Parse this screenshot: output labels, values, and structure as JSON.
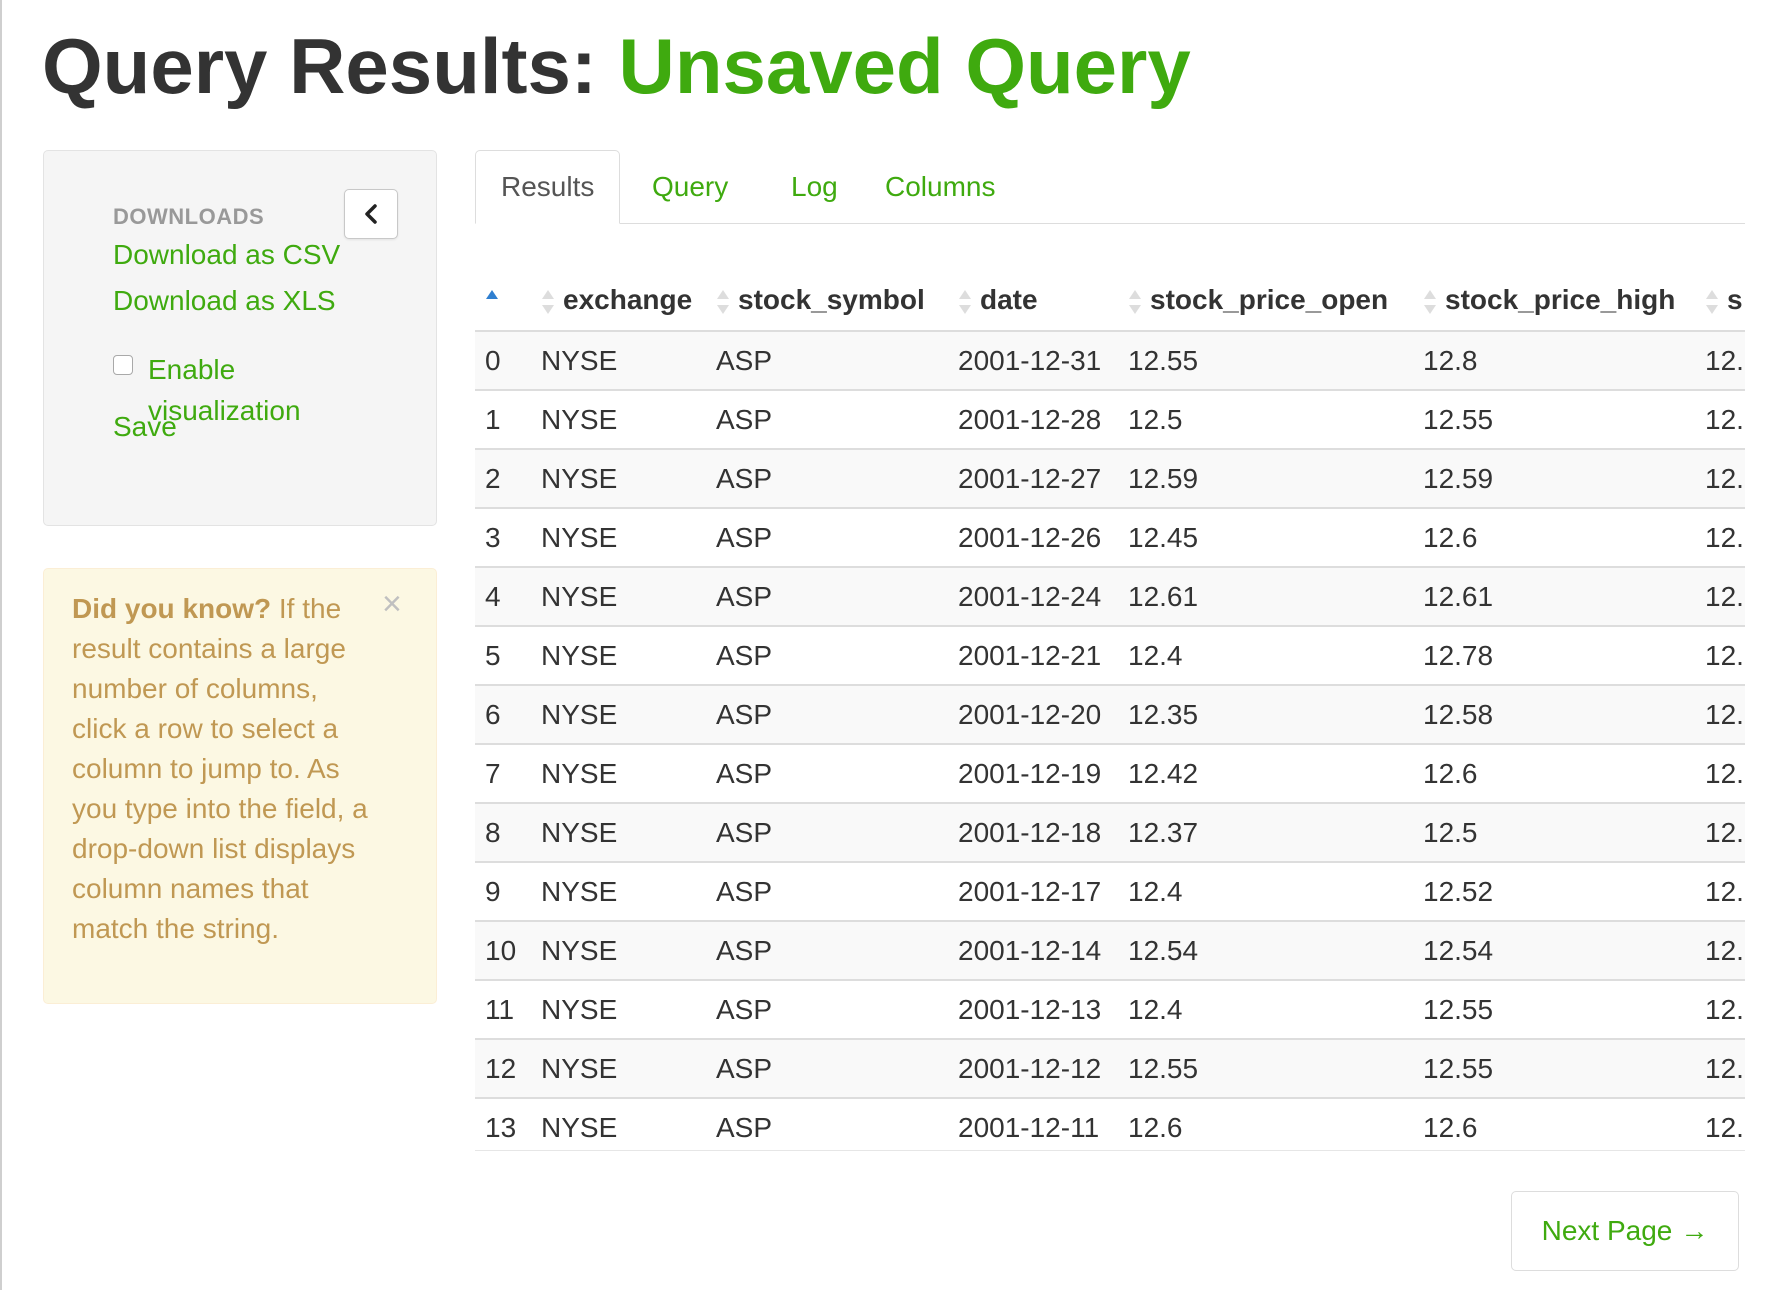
{
  "page": {
    "title_prefix": "Query Results:",
    "title_query": "Unsaved Query"
  },
  "sidebar": {
    "downloads_header": "DOWNLOADS",
    "collapse_icon": "chevron-left-icon",
    "links": {
      "csv": "Download as CSV",
      "xls": "Download as XLS",
      "enable_viz": "Enable visualization",
      "save": "Save"
    },
    "enable_viz_checked": false
  },
  "tip": {
    "heading": "Did you know?",
    "body": "If the result contains a large number of columns, click a row to select a column to jump to. As you type into the field, a drop-down list displays column names that match the string.",
    "close_icon": "close-icon"
  },
  "tabs": [
    {
      "label": "Results",
      "active": true
    },
    {
      "label": "Query",
      "active": false
    },
    {
      "label": "Log",
      "active": false
    },
    {
      "label": "Columns",
      "active": false
    }
  ],
  "table": {
    "columns": [
      "",
      "exchange",
      "stock_symbol",
      "date",
      "stock_price_open",
      "stock_price_high",
      "s"
    ],
    "rows": [
      [
        "0",
        "NYSE",
        "ASP",
        "2001-12-31",
        "12.55",
        "12.8",
        "12."
      ],
      [
        "1",
        "NYSE",
        "ASP",
        "2001-12-28",
        "12.5",
        "12.55",
        "12."
      ],
      [
        "2",
        "NYSE",
        "ASP",
        "2001-12-27",
        "12.59",
        "12.59",
        "12."
      ],
      [
        "3",
        "NYSE",
        "ASP",
        "2001-12-26",
        "12.45",
        "12.6",
        "12."
      ],
      [
        "4",
        "NYSE",
        "ASP",
        "2001-12-24",
        "12.61",
        "12.61",
        "12."
      ],
      [
        "5",
        "NYSE",
        "ASP",
        "2001-12-21",
        "12.4",
        "12.78",
        "12."
      ],
      [
        "6",
        "NYSE",
        "ASP",
        "2001-12-20",
        "12.35",
        "12.58",
        "12."
      ],
      [
        "7",
        "NYSE",
        "ASP",
        "2001-12-19",
        "12.42",
        "12.6",
        "12."
      ],
      [
        "8",
        "NYSE",
        "ASP",
        "2001-12-18",
        "12.37",
        "12.5",
        "12."
      ],
      [
        "9",
        "NYSE",
        "ASP",
        "2001-12-17",
        "12.4",
        "12.52",
        "12."
      ],
      [
        "10",
        "NYSE",
        "ASP",
        "2001-12-14",
        "12.54",
        "12.54",
        "12."
      ],
      [
        "11",
        "NYSE",
        "ASP",
        "2001-12-13",
        "12.4",
        "12.55",
        "12."
      ],
      [
        "12",
        "NYSE",
        "ASP",
        "2001-12-12",
        "12.55",
        "12.55",
        "12."
      ],
      [
        "13",
        "NYSE",
        "ASP",
        "2001-12-11",
        "12.6",
        "12.6",
        "12."
      ]
    ],
    "sort": {
      "column": 0,
      "direction": "ascending"
    }
  },
  "pagination": {
    "next_label": "Next Page",
    "next_arrow": "→"
  },
  "colors": {
    "accent_green": "#3faa0f",
    "sort_active_blue": "#2f7fd0",
    "tip_text": "#c09853",
    "tip_background": "#fcf8e3"
  }
}
